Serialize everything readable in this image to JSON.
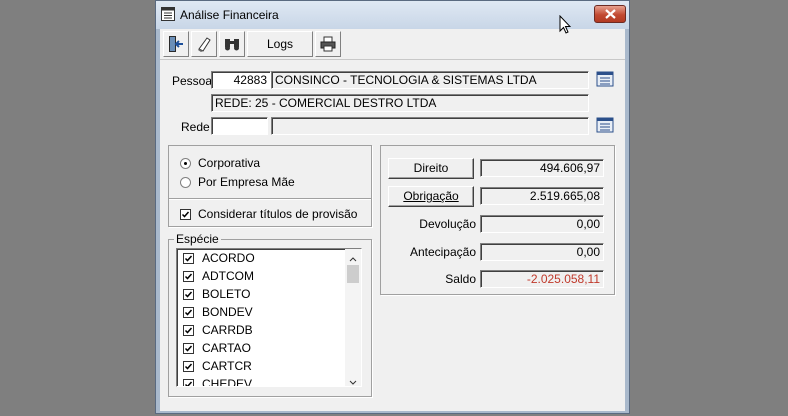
{
  "window": {
    "title": "Análise Financeira"
  },
  "toolbar": {
    "logs_label": "Logs"
  },
  "pessoa": {
    "label": "Pessoa",
    "code": "42883",
    "name": "CONSINCO - TECNOLOGIA & SISTEMAS LTDA",
    "rede_info": "REDE: 25 - COMERCIAL DESTRO LTDA"
  },
  "rede": {
    "label": "Rede",
    "code": "",
    "name": ""
  },
  "options": {
    "corporativa": "Corporativa",
    "por_empresa_mae": "Por Empresa Mãe",
    "selected": "corporativa",
    "considerar": "Considerar títulos de provisão",
    "considerar_checked": true
  },
  "especie": {
    "label": "Espécie",
    "items": [
      {
        "label": "ACORDO",
        "checked": true
      },
      {
        "label": "ADTCOM",
        "checked": true
      },
      {
        "label": "BOLETO",
        "checked": true
      },
      {
        "label": "BONDEV",
        "checked": true
      },
      {
        "label": "CARRDB",
        "checked": true
      },
      {
        "label": "CARTAO",
        "checked": true
      },
      {
        "label": "CARTCR",
        "checked": true
      },
      {
        "label": "CHEDEV",
        "checked": true
      }
    ]
  },
  "summary": {
    "direito_label": "Direito",
    "direito": "494.606,97",
    "obrigacao_label": "Obrigação",
    "obrigacao": "2.519.665,08",
    "devolucao_label": "Devolução",
    "devolucao": "0,00",
    "antecipacao_label": "Antecipação",
    "antecipacao": "0,00",
    "saldo_label": "Saldo",
    "saldo": "-2.025.058,11"
  },
  "colors": {
    "negative": "#c0392b",
    "title_bg": "#c8d6e7",
    "close": "#c24a32"
  },
  "icons": [
    "app-icon",
    "exit-icon",
    "eraser-icon",
    "binoculars-icon",
    "printer-icon",
    "lookup-icon",
    "close-icon",
    "mouse-cursor-icon"
  ]
}
